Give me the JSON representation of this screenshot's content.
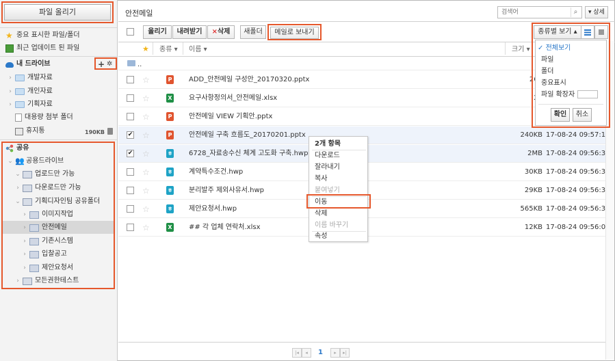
{
  "sidebar": {
    "upload_label": "파일 올리기",
    "starred": "중요 표시한 파일/폴더",
    "recent": "최근 업데이트 된 파일",
    "mydrive_title": "내 드라이브",
    "mydrive_add": "+",
    "mydrive_gear": "✲",
    "mydrive_items": [
      "개발자료",
      "개인자료",
      "기획자료",
      "대용량 첨부 폴더"
    ],
    "trash_label": "휴지통",
    "trash_size": "190KB",
    "share_title": "공유",
    "share_tree": {
      "root": "공용드라이브",
      "upload_only": "업로드만 가능",
      "download_only": "다운로드만 가능",
      "planning": "기획디자인팀 공유폴더",
      "sub": [
        "이미지작업",
        "안전메일",
        "기존시스템",
        "입찰공고",
        "제안요청서"
      ],
      "all_perm": "모든권한테스트"
    }
  },
  "main": {
    "title": "안전메일",
    "search_placeholder": "검색어",
    "detail_label": "▾ 상세",
    "toolbar": {
      "upload": "올리기",
      "download": "내려받기",
      "delete": "삭제",
      "delete_x": "×",
      "new_folder": "새폴더",
      "mail": "메일로 보내기"
    },
    "view": {
      "button": "종류별 보기 ▴",
      "options": [
        "전체보기",
        "파일",
        "폴더",
        "중요표시",
        "파일 확장자"
      ],
      "checked_mark": "✓",
      "confirm": "확인",
      "cancel": "취소"
    },
    "columns": {
      "type": "종류 ▾",
      "name": "이름 ▾",
      "size": "크기 ▾"
    },
    "parent_label": "..",
    "rows": [
      {
        "type": "P",
        "name": "ADD_안전메일 구성안_20170320.pptx",
        "size": "268",
        "date": "",
        "checked": ""
      },
      {
        "type": "X",
        "name": "요구사항정의서_안전메일.xlsx",
        "size": "29",
        "date": "",
        "checked": ""
      },
      {
        "type": "P",
        "name": "안전메일 VIEW 기획안.pptx",
        "size": "2",
        "date": "",
        "checked": ""
      },
      {
        "type": "P",
        "name": "안전메일 구축 흐름도_20170201.pptx",
        "size": "240KB",
        "date": "17-08-24 09:57:16",
        "checked": "✔"
      },
      {
        "type": "ㅎ",
        "name": "6728_자료송수신 체계 고도화 구축.hwp",
        "size": "2MB",
        "date": "17-08-24 09:56:32",
        "checked": "✔"
      },
      {
        "type": "ㅎ",
        "name": "계약특수조건.hwp",
        "size": "30KB",
        "date": "17-08-24 09:56:32",
        "checked": ""
      },
      {
        "type": "ㅎ",
        "name": "분리발주 제외사유서.hwp",
        "size": "29KB",
        "date": "17-08-24 09:56:32",
        "checked": ""
      },
      {
        "type": "ㅎ",
        "name": "제안요청서.hwp",
        "size": "565KB",
        "date": "17-08-24 09:56:32",
        "checked": ""
      },
      {
        "type": "X",
        "name": "## 각 업체 연락처.xlsx",
        "size": "12KB",
        "date": "17-08-24 09:56:02",
        "checked": ""
      }
    ],
    "context_menu": {
      "header": "2개 항목",
      "items": [
        "다운로드",
        "잘라내기",
        "복사",
        "붙여넣기",
        "이동",
        "삭제",
        "이름 바꾸기",
        "속성"
      ]
    },
    "pager": {
      "first": "|◂",
      "prev": "◂",
      "page": "1",
      "next": "▸",
      "last": "▸|"
    }
  }
}
